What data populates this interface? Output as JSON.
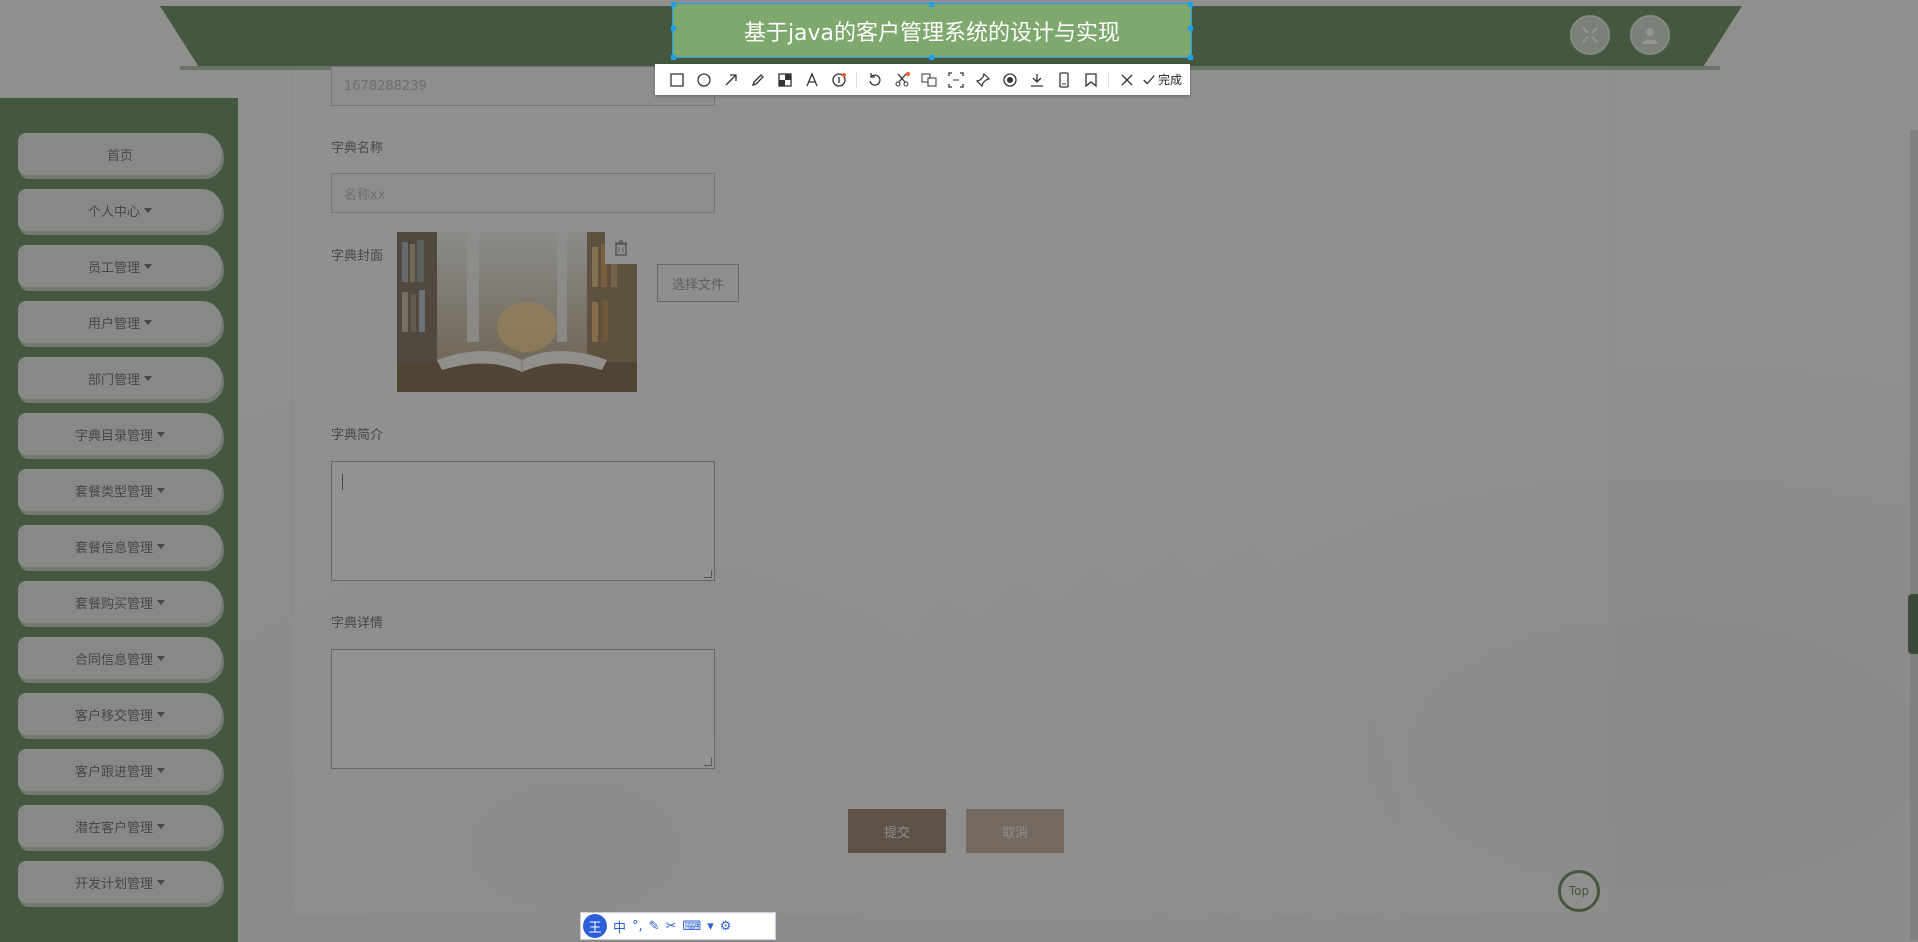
{
  "app": {
    "title": "基于java的客户管理系统的设计与实现"
  },
  "sidebar": {
    "items": [
      {
        "label": "首页",
        "has_dropdown": false
      },
      {
        "label": "个人中心",
        "has_dropdown": true
      },
      {
        "label": "员工管理",
        "has_dropdown": true
      },
      {
        "label": "用户管理",
        "has_dropdown": true
      },
      {
        "label": "部门管理",
        "has_dropdown": true
      },
      {
        "label": "字典目录管理",
        "has_dropdown": true
      },
      {
        "label": "套餐类型管理",
        "has_dropdown": true
      },
      {
        "label": "套餐信息管理",
        "has_dropdown": true
      },
      {
        "label": "套餐购买管理",
        "has_dropdown": true
      },
      {
        "label": "合同信息管理",
        "has_dropdown": true
      },
      {
        "label": "客户移交管理",
        "has_dropdown": true
      },
      {
        "label": "客户跟进管理",
        "has_dropdown": true
      },
      {
        "label": "潜在客户管理",
        "has_dropdown": true
      },
      {
        "label": "开发计划管理",
        "has_dropdown": true
      }
    ]
  },
  "form": {
    "code_value": "1678288239",
    "name_label": "字典名称",
    "name_placeholder": "名称xx",
    "cover_label": "字典封面",
    "file_button": "选择文件",
    "intro_label": "字典简介",
    "detail_label": "字典详情",
    "submit": "提交",
    "cancel": "取消"
  },
  "capture_toolbar": {
    "tools": [
      "rectangle-icon",
      "ellipse-icon",
      "arrow-icon",
      "pencil-icon",
      "mosaic-icon",
      "text-icon",
      "number-icon",
      "undo-icon",
      "cut-icon",
      "ocr-icon",
      "translate-icon",
      "pin-icon",
      "record-icon",
      "download-icon",
      "long-screenshot-icon",
      "bookmark-icon",
      "close-icon"
    ],
    "done_label": "完成"
  },
  "top_button": "Top",
  "ime": {
    "logo": "王",
    "mode": "中"
  },
  "colors": {
    "brand_green": "#4f7a45",
    "selection_green": "#7fa86e",
    "selection_outline": "#1da1f2"
  }
}
